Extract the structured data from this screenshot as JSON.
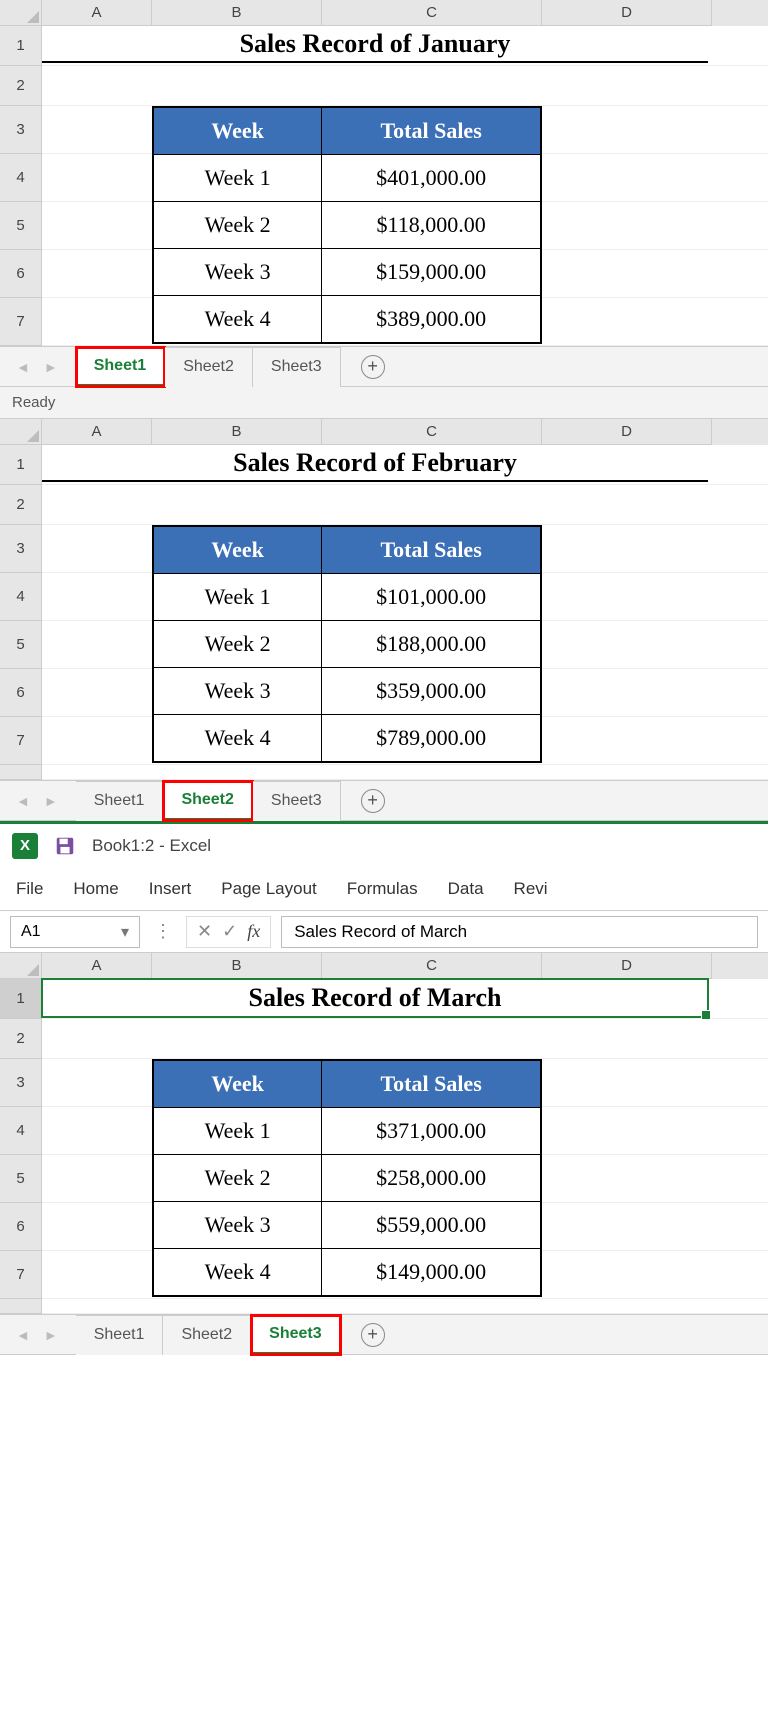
{
  "panel1": {
    "cols": {
      "A": "A",
      "B": "B",
      "C": "C",
      "D": "D"
    },
    "rows": [
      "1",
      "2",
      "3",
      "4",
      "5",
      "6",
      "7"
    ],
    "title": "Sales Record of January",
    "th_week": "Week",
    "th_total": "Total Sales",
    "data": [
      {
        "week": "Week 1",
        "sales": "$401,000.00"
      },
      {
        "week": "Week 2",
        "sales": "$118,000.00"
      },
      {
        "week": "Week 3",
        "sales": "$159,000.00"
      },
      {
        "week": "Week 4",
        "sales": "$389,000.00"
      }
    ],
    "tabs": {
      "s1": "Sheet1",
      "s2": "Sheet2",
      "s3": "Sheet3"
    },
    "status": "Ready"
  },
  "panel2": {
    "cols": {
      "A": "A",
      "B": "B",
      "C": "C",
      "D": "D"
    },
    "rows": [
      "1",
      "2",
      "3",
      "4",
      "5",
      "6",
      "7"
    ],
    "title": "Sales Record of February",
    "th_week": "Week",
    "th_total": "Total Sales",
    "data": [
      {
        "week": "Week 1",
        "sales": "$101,000.00"
      },
      {
        "week": "Week 2",
        "sales": "$188,000.00"
      },
      {
        "week": "Week 3",
        "sales": "$359,000.00"
      },
      {
        "week": "Week 4",
        "sales": "$789,000.00"
      }
    ],
    "tabs": {
      "s1": "Sheet1",
      "s2": "Sheet2",
      "s3": "Sheet3"
    }
  },
  "panel3": {
    "titlebar": "Book1:2  -  Excel",
    "ribbon": {
      "file": "File",
      "home": "Home",
      "insert": "Insert",
      "pagelayout": "Page Layout",
      "formulas": "Formulas",
      "data": "Data",
      "review": "Revi"
    },
    "namebox": "A1",
    "fx": "Sales Record of March",
    "cols": {
      "A": "A",
      "B": "B",
      "C": "C",
      "D": "D"
    },
    "rows": [
      "1",
      "2",
      "3",
      "4",
      "5",
      "6",
      "7"
    ],
    "title": "Sales Record of March",
    "th_week": "Week",
    "th_total": "Total Sales",
    "data": [
      {
        "week": "Week 1",
        "sales": "$371,000.00"
      },
      {
        "week": "Week 2",
        "sales": "$258,000.00"
      },
      {
        "week": "Week 3",
        "sales": "$559,000.00"
      },
      {
        "week": "Week 4",
        "sales": "$149,000.00"
      }
    ],
    "tabs": {
      "s1": "Sheet1",
      "s2": "Sheet2",
      "s3": "Sheet3"
    }
  },
  "chart_data": [
    {
      "type": "table",
      "title": "Sales Record of January",
      "columns": [
        "Week",
        "Total Sales"
      ],
      "rows": [
        [
          "Week 1",
          401000.0
        ],
        [
          "Week 2",
          118000.0
        ],
        [
          "Week 3",
          159000.0
        ],
        [
          "Week 4",
          389000.0
        ]
      ]
    },
    {
      "type": "table",
      "title": "Sales Record of February",
      "columns": [
        "Week",
        "Total Sales"
      ],
      "rows": [
        [
          "Week 1",
          101000.0
        ],
        [
          "Week 2",
          188000.0
        ],
        [
          "Week 3",
          359000.0
        ],
        [
          "Week 4",
          789000.0
        ]
      ]
    },
    {
      "type": "table",
      "title": "Sales Record of March",
      "columns": [
        "Week",
        "Total Sales"
      ],
      "rows": [
        [
          "Week 1",
          371000.0
        ],
        [
          "Week 2",
          258000.0
        ],
        [
          "Week 3",
          559000.0
        ],
        [
          "Week 4",
          149000.0
        ]
      ]
    }
  ]
}
